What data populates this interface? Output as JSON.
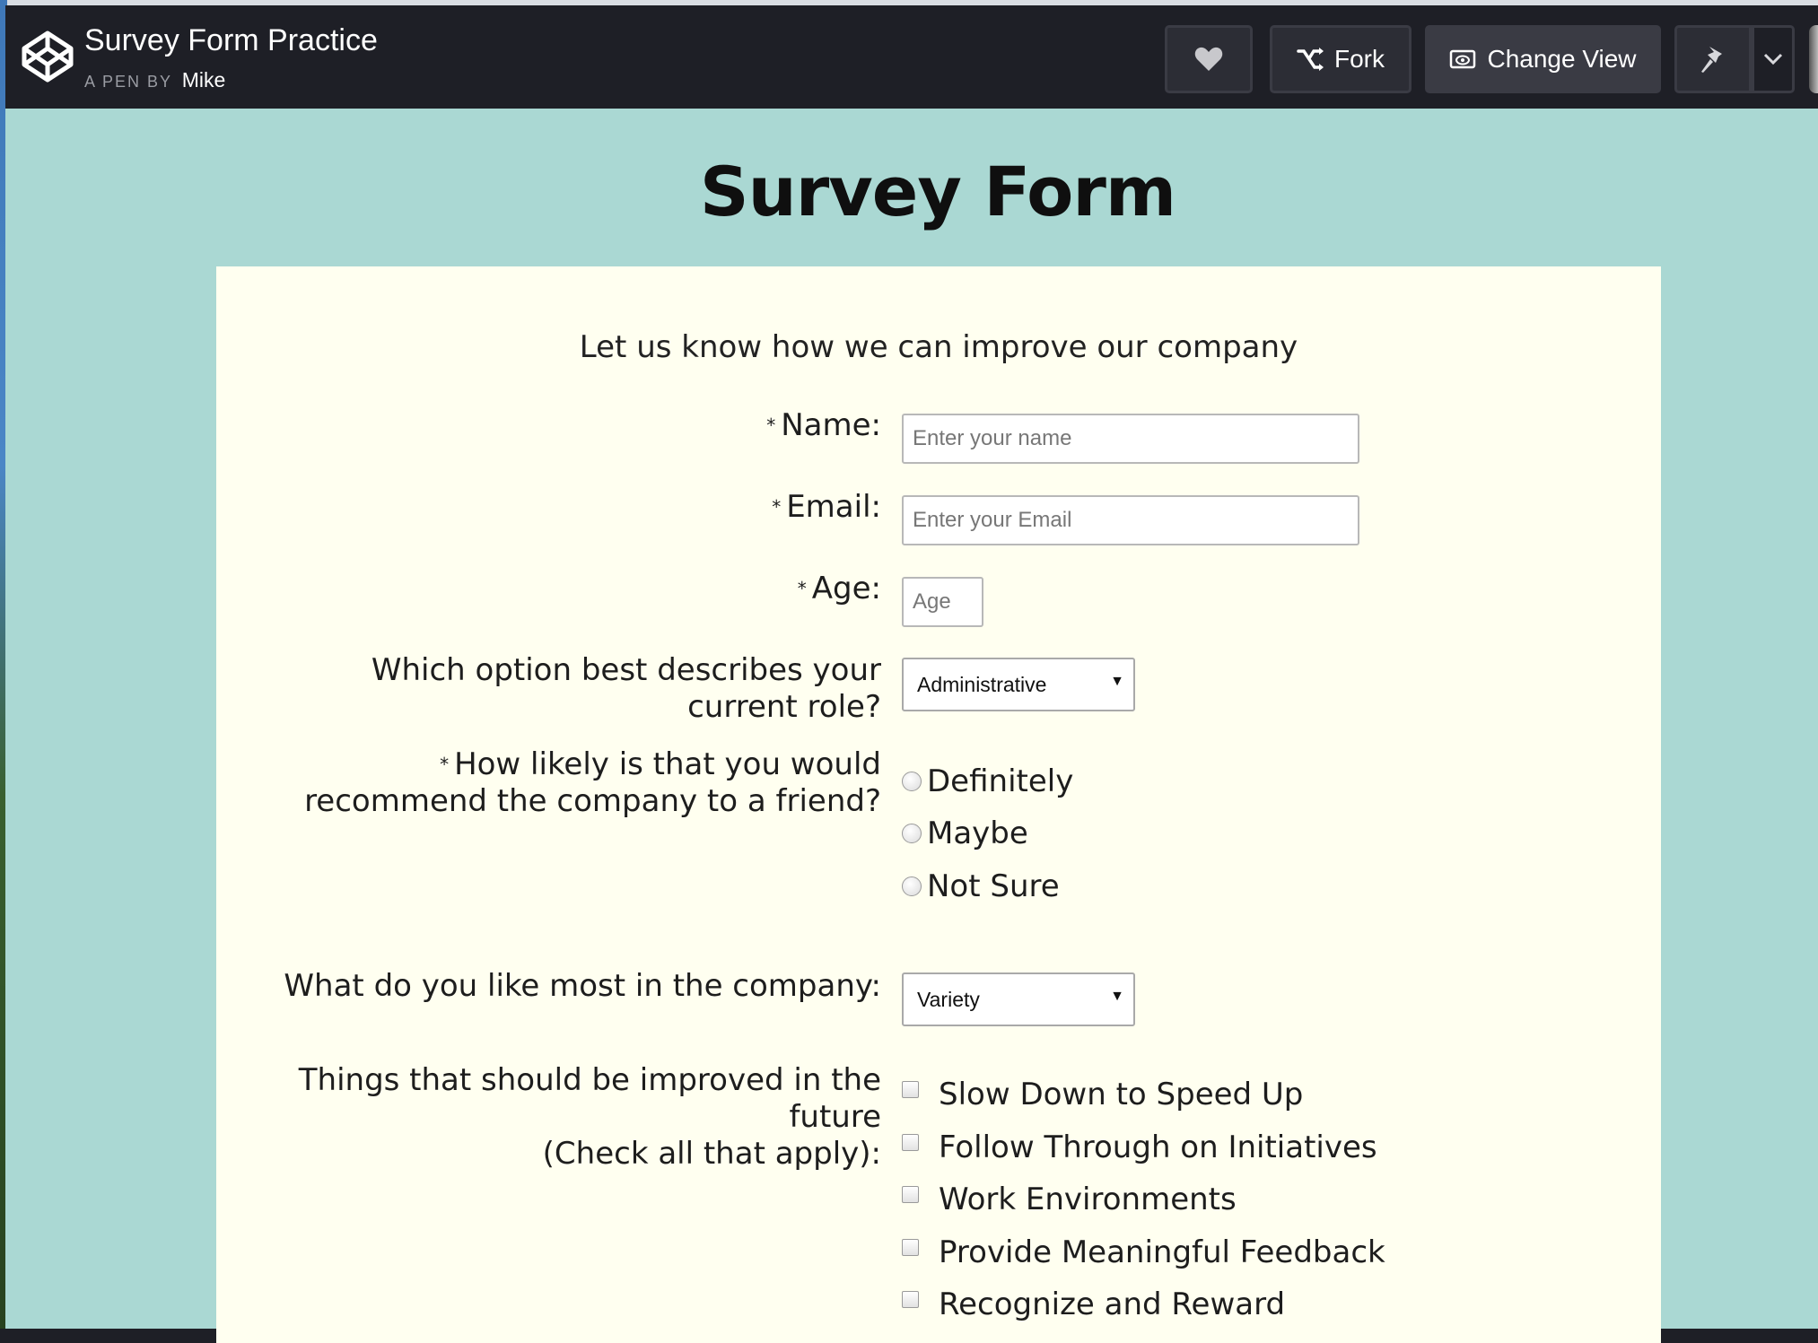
{
  "topbar": {
    "pen_title": "Survey Form Practice",
    "pen_by": "A PEN BY",
    "author": "Mike",
    "fork_label": "Fork",
    "change_view_label": "Change View"
  },
  "icons": {
    "logo": "codepen-cube-icon",
    "heart": "heart-icon",
    "fork": "fork-icon",
    "view": "eye-icon",
    "pin": "pin-icon",
    "dropdown": "chevron-down-icon"
  },
  "colors": {
    "topbar_bg": "#1e1f26",
    "page_bg": "#aad8d3",
    "card_bg": "#fffff0"
  },
  "page": {
    "title": "Survey Form"
  },
  "form": {
    "lead": "Let us know how we can improve our company",
    "required_mark": "*",
    "name": {
      "label": "Name:",
      "placeholder": "Enter your name"
    },
    "email": {
      "label": "Email:",
      "placeholder": "Enter your Email"
    },
    "age": {
      "label": "Age:",
      "placeholder": "Age"
    },
    "role": {
      "label_line1": "Which option best describes your",
      "label_line2": "current role?",
      "selected": "Administrative"
    },
    "recommend": {
      "label_line1": "How likely is that you would",
      "label_line2": "recommend the company to a friend?",
      "options": [
        "Definitely",
        "Maybe",
        "Not Sure"
      ]
    },
    "like_most": {
      "label": "What do you like most in the company:",
      "selected": "Variety"
    },
    "improve": {
      "label_line1": "Things that should be improved in the",
      "label_line2": "future",
      "label_line3": "(Check all that apply):",
      "options": [
        "Slow Down to Speed Up",
        "Follow Through on Initiatives",
        "Work Environments",
        "Provide Meaningful Feedback",
        "Recognize and Reward"
      ]
    }
  }
}
